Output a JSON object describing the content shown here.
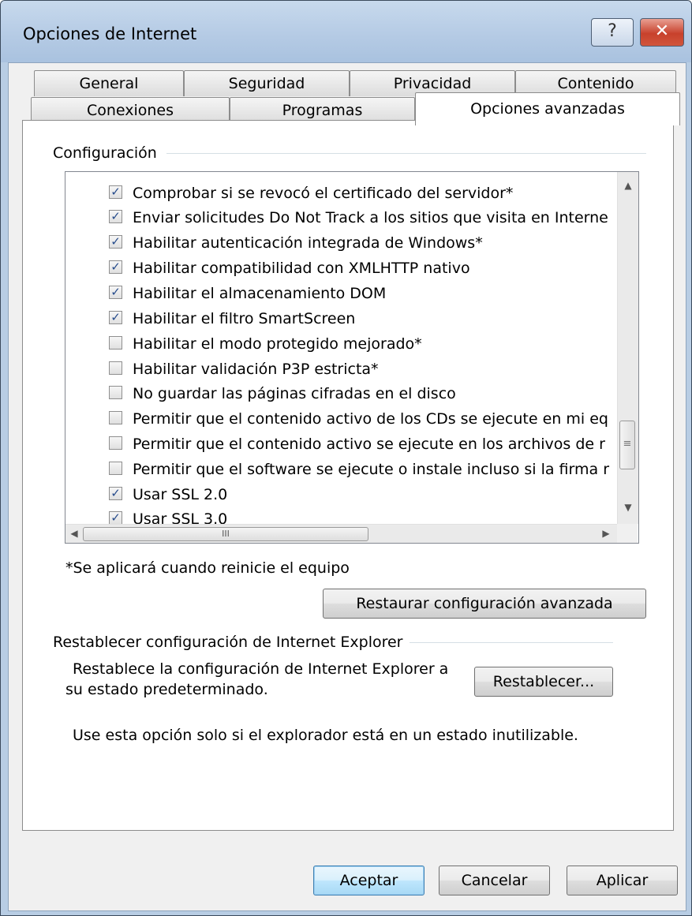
{
  "window": {
    "title": "Opciones de Internet",
    "help_glyph": "?",
    "close_glyph": "✕"
  },
  "tabs_row1": [
    "General",
    "Seguridad",
    "Privacidad",
    "Contenido"
  ],
  "tabs_row2": [
    "Conexiones",
    "Programas",
    "Opciones avanzadas"
  ],
  "active_tab": "Opciones avanzadas",
  "config": {
    "label": "Configuración",
    "items": [
      {
        "label": "Comprobar si se revocó el certificado del servidor*",
        "checked": true
      },
      {
        "label": "Enviar solicitudes Do Not Track a los sitios que visita en Interne",
        "checked": true
      },
      {
        "label": "Habilitar autenticación integrada de Windows*",
        "checked": true
      },
      {
        "label": "Habilitar compatibilidad con XMLHTTP nativo",
        "checked": true
      },
      {
        "label": "Habilitar el almacenamiento DOM",
        "checked": true
      },
      {
        "label": "Habilitar el filtro SmartScreen",
        "checked": true
      },
      {
        "label": "Habilitar el modo protegido mejorado*",
        "checked": false
      },
      {
        "label": "Habilitar validación P3P estricta*",
        "checked": false
      },
      {
        "label": "No guardar las páginas cifradas en el disco",
        "checked": false
      },
      {
        "label": "Permitir que el contenido activo de los CDs se ejecute en mi eq",
        "checked": false
      },
      {
        "label": "Permitir que el contenido activo se ejecute en los archivos de r",
        "checked": false
      },
      {
        "label": "Permitir que el software se ejecute o instale incluso si la firma r",
        "checked": false
      },
      {
        "label": "Usar SSL 2.0",
        "checked": true
      },
      {
        "label": "Usar SSL 3.0",
        "checked": true
      }
    ],
    "footnote": "*Se aplicará cuando reinicie el equipo",
    "restore_button": "Restaurar configuración avanzada"
  },
  "reset": {
    "label": "Restablecer configuración de Internet Explorer",
    "description_line1": "Restablece la configuración de Internet Explorer a",
    "description_line2": "su estado predeterminado.",
    "button": "Restablecer...",
    "note": "Use esta opción solo si el explorador está en un estado inutilizable."
  },
  "footer": {
    "ok": "Aceptar",
    "cancel": "Cancelar",
    "apply": "Aplicar"
  },
  "scrollbar": {
    "up": "▲",
    "down": "▼",
    "left": "◀",
    "right": "▶",
    "v_grip": "≡",
    "h_grip": "III"
  }
}
